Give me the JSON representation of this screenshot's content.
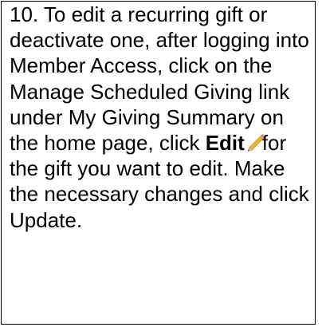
{
  "instruction": {
    "part1": "10. To edit a recurring gift or deactivate one, after logging into Member Access, click on the Manage Scheduled Giving link under My Giving Summary on the home page, click ",
    "edit_label": "Edit",
    "edit_icon": "pencil-icon",
    "part2": "for the gift you want to edit. Make the necessary changes and click Update."
  }
}
